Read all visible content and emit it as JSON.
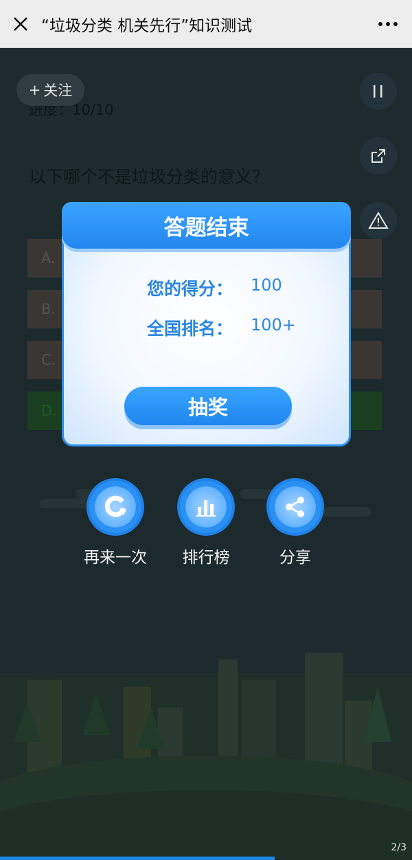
{
  "header": {
    "title": "“垃圾分类 机关先行”知识测试"
  },
  "overlay": {
    "follow_label": "关注"
  },
  "quiz": {
    "progress": "进度：10/10",
    "question": "以下哪个不是垃圾分类的意义？",
    "options": [
      "A.",
      "B.",
      "C.",
      "D."
    ]
  },
  "modal": {
    "title": "答题结束",
    "score_label": "您的得分：",
    "score_value": "100",
    "rank_label": "全国排名：",
    "rank_value": "100+",
    "lottery_label": "抽奖"
  },
  "actions": [
    {
      "label": "再来一次",
      "icon": "replay-icon"
    },
    {
      "label": "排行榜",
      "icon": "leaderboard-icon"
    },
    {
      "label": "分享",
      "icon": "share-icon"
    }
  ],
  "footer": {
    "page": "2/3"
  },
  "colors": {
    "accent": "#2287f0",
    "background": "#1c2a2d"
  }
}
